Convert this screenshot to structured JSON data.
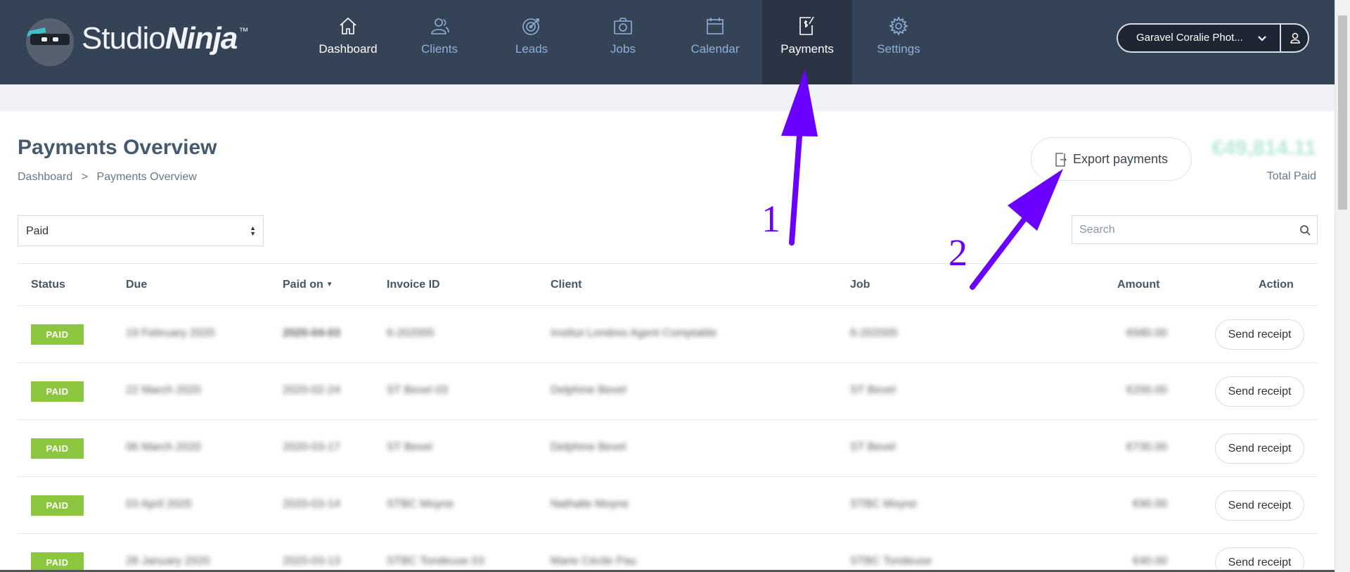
{
  "app": {
    "brand_part1": "Studio",
    "brand_part2": "Ninja",
    "brand_mark": "™"
  },
  "nav": {
    "items": [
      {
        "label": "Dashboard",
        "icon": "home-icon"
      },
      {
        "label": "Clients",
        "icon": "users-icon"
      },
      {
        "label": "Leads",
        "icon": "target-icon"
      },
      {
        "label": "Jobs",
        "icon": "camera-icon"
      },
      {
        "label": "Calendar",
        "icon": "calendar-icon"
      },
      {
        "label": "Payments",
        "icon": "payments-icon",
        "active": true
      },
      {
        "label": "Settings",
        "icon": "gear-icon"
      }
    ]
  },
  "account": {
    "name": "Garavel Coralie Phot..."
  },
  "page": {
    "title": "Payments Overview",
    "breadcrumb": [
      "Dashboard",
      ">",
      "Payments Overview"
    ]
  },
  "actions": {
    "export_label": "Export payments"
  },
  "totals": {
    "amount": "€49,814.11",
    "label": "Total Paid"
  },
  "filter": {
    "selected": "Paid"
  },
  "search": {
    "placeholder": "Search",
    "value": ""
  },
  "table": {
    "columns": [
      "Status",
      "Due",
      "Paid on",
      "Invoice ID",
      "Client",
      "Job",
      "Amount",
      "Action"
    ],
    "rows": [
      {
        "status": "PAID",
        "due": "19 February 2020",
        "paid_on": "2020-04-03",
        "invoice": "6-202005",
        "client": "Institut Londres Agent Comptable",
        "job": "6-202005",
        "amount": "€680.00",
        "action": "Send receipt"
      },
      {
        "status": "PAID",
        "due": "22 March 2020",
        "paid_on": "2020-02-24",
        "invoice": "ST Bevel 03",
        "client": "Delphine Bevel",
        "job": "ST Bevel",
        "amount": "€200.00",
        "action": "Send receipt"
      },
      {
        "status": "PAID",
        "due": "06 March 2020",
        "paid_on": "2020-03-17",
        "invoice": "ST Bevel",
        "client": "Delphine Bevel",
        "job": "ST Bevel",
        "amount": "€730.00",
        "action": "Send receipt"
      },
      {
        "status": "PAID",
        "due": "03 April 2020",
        "paid_on": "2020-03-14",
        "invoice": "STBC Moyne",
        "client": "Nathalie Moyne",
        "job": "STBC Moyne",
        "amount": "€90.00",
        "action": "Send receipt"
      },
      {
        "status": "PAID",
        "due": "28 January 2020",
        "paid_on": "2020-03-13",
        "invoice": "STBC Tondeuse 03",
        "client": "Marie Cécile Pau",
        "job": "STBC Tondeuse",
        "amount": "€40.00",
        "action": "Send receipt"
      }
    ]
  },
  "annotations": {
    "arrow1_label": "1",
    "arrow2_label": "2",
    "color": "#6a00ff"
  },
  "colors": {
    "header_bg": "#354357",
    "nav_active_bg": "#2a3445",
    "paid_badge": "#8cc63f",
    "accent_blue": "#8fb0d8"
  }
}
